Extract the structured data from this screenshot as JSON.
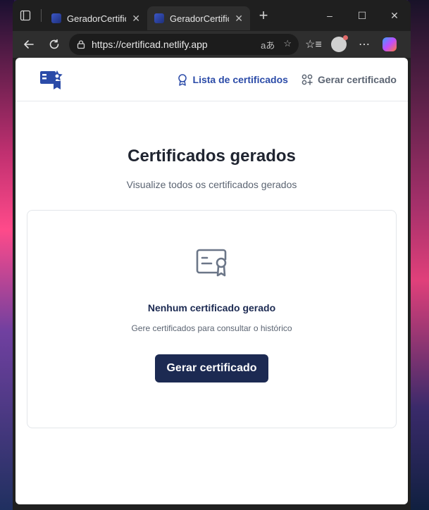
{
  "browser": {
    "tabs": [
      {
        "title": "GeradorCertificados",
        "active": false
      },
      {
        "title": "GeradorCertificados",
        "active": true
      }
    ],
    "url": "https://certificad.netlify.app",
    "window_controls": {
      "minimize": "–",
      "maximize": "☐",
      "close": "✕"
    }
  },
  "site": {
    "nav": {
      "list_label": "Lista de certificados",
      "create_label": "Gerar certificado"
    },
    "page": {
      "title": "Certificados gerados",
      "subtitle": "Visualize todos os certificados gerados"
    },
    "empty_state": {
      "title": "Nenhum certificado gerado",
      "description": "Gere certificados para consultar o histórico",
      "button_label": "Gerar certificado"
    },
    "colors": {
      "brand": "#2b4ba8",
      "primary_button": "#1c2a52",
      "muted_text": "#5b6472"
    }
  }
}
